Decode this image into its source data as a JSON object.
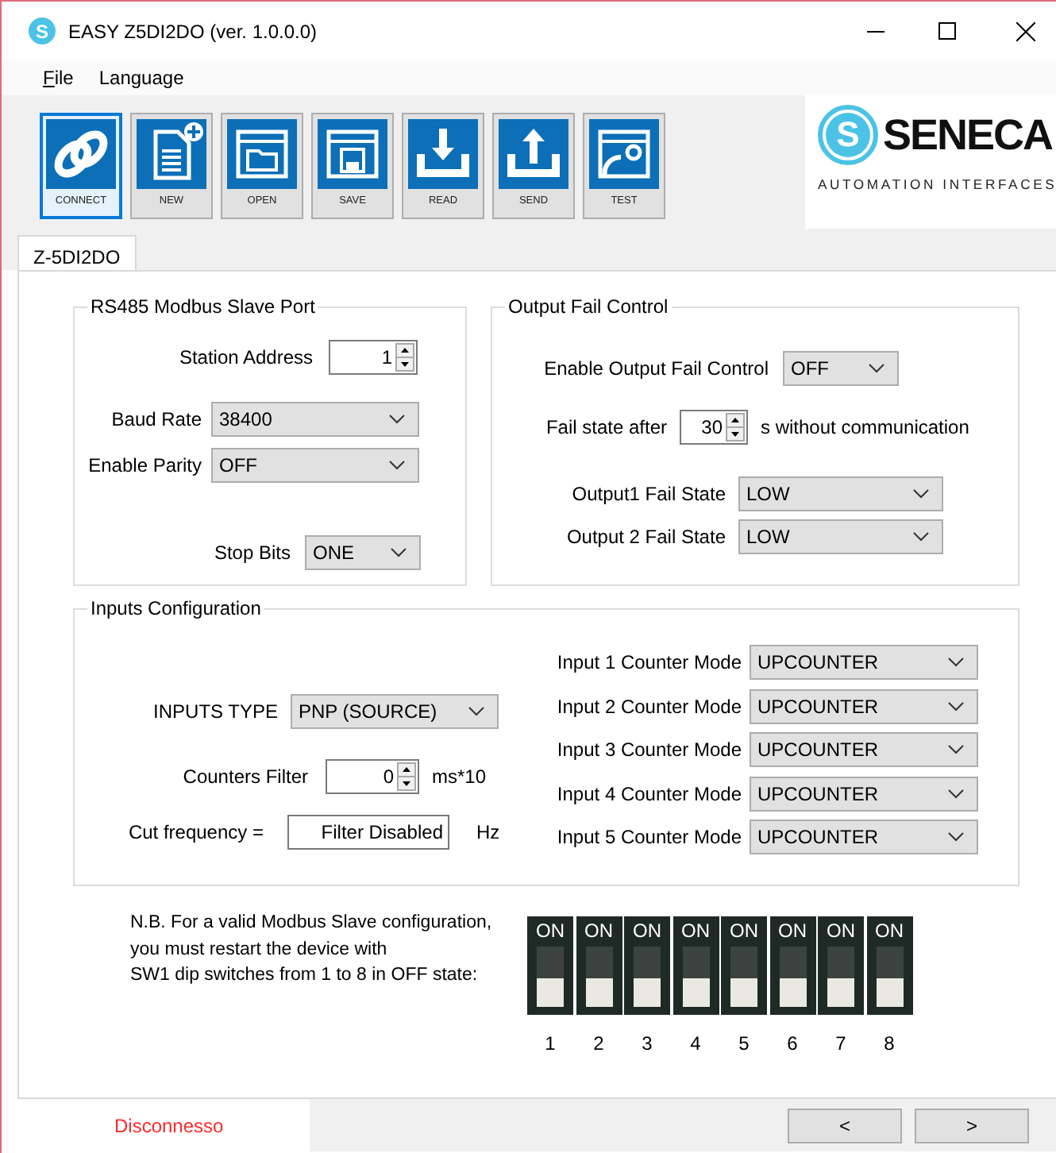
{
  "window": {
    "title": "EASY Z5DI2DO (ver. 1.0.0.0)",
    "icon_letter": "S"
  },
  "menu": [
    {
      "label": "File",
      "mnemonic_underlined": true
    },
    {
      "label": "Language",
      "mnemonic_underlined": false
    }
  ],
  "toolbar": [
    {
      "label": "CONNECT",
      "selected": true
    },
    {
      "label": "NEW",
      "selected": false
    },
    {
      "label": "OPEN",
      "selected": false
    },
    {
      "label": "SAVE",
      "selected": false
    },
    {
      "label": "READ",
      "selected": false
    },
    {
      "label": "SEND",
      "selected": false
    },
    {
      "label": "TEST",
      "selected": false
    }
  ],
  "logo": {
    "letter": "S",
    "name": "SENECA",
    "tagline": "AUTOMATION INTERFACES"
  },
  "tabs": [
    {
      "label": "Z-5DI2DO",
      "selected": true
    }
  ],
  "rs485": {
    "title": "RS485 Modbus Slave Port",
    "fields": [
      {
        "label": "Station Address",
        "kind": "spin",
        "value": "1"
      },
      {
        "label": "Baud Rate",
        "kind": "combo",
        "value": "38400"
      },
      {
        "label": "Enable Parity",
        "kind": "combo",
        "value": "OFF"
      },
      {
        "label": "Stop Bits",
        "kind": "combo",
        "value": "ONE"
      }
    ]
  },
  "output_fail": {
    "title": "Output Fail Control",
    "fields": [
      {
        "label": "Enable Output Fail Control",
        "kind": "combo",
        "value": "OFF"
      },
      {
        "label": "Fail state after",
        "kind": "spin",
        "value": "30",
        "suffix": "s without communication"
      },
      {
        "label": "Output1 Fail State",
        "kind": "combo",
        "value": "LOW"
      },
      {
        "label": "Output 2 Fail State",
        "kind": "combo",
        "value": "LOW"
      }
    ]
  },
  "inputs": {
    "title": "Inputs Configuration",
    "fields": [
      {
        "label": "INPUTS TYPE",
        "kind": "combo",
        "value": "PNP (SOURCE)"
      },
      {
        "label": "Counters Filter",
        "kind": "spin",
        "value": "0",
        "suffix": "ms*10"
      },
      {
        "label": "Cut frequency =",
        "kind": "text",
        "value": "Filter Disabled",
        "suffix": "Hz"
      }
    ],
    "counter_modes": [
      {
        "label": "Input 1 Counter Mode",
        "value": "UPCOUNTER"
      },
      {
        "label": "Input 2 Counter Mode",
        "value": "UPCOUNTER"
      },
      {
        "label": "Input 3 Counter Mode",
        "value": "UPCOUNTER"
      },
      {
        "label": "Input 4 Counter Mode",
        "value": "UPCOUNTER"
      },
      {
        "label": "Input 5 Counter Mode",
        "value": "UPCOUNTER"
      }
    ]
  },
  "note": "N.B. For a valid Modbus Slave configuration,\nyou must restart the device with\nSW1 dip switches from 1 to 8 in OFF state:",
  "dip_switches": [
    {
      "label": "ON",
      "number": "1",
      "on": false
    },
    {
      "label": "ON",
      "number": "2",
      "on": false
    },
    {
      "label": "ON",
      "number": "3",
      "on": false
    },
    {
      "label": "ON",
      "number": "4",
      "on": false
    },
    {
      "label": "ON",
      "number": "5",
      "on": false
    },
    {
      "label": "ON",
      "number": "6",
      "on": false
    },
    {
      "label": "ON",
      "number": "7",
      "on": false
    },
    {
      "label": "ON",
      "number": "8",
      "on": false
    }
  ],
  "status_bar": {
    "text": "Disconnesso",
    "buttons": [
      "<",
      ">"
    ]
  }
}
